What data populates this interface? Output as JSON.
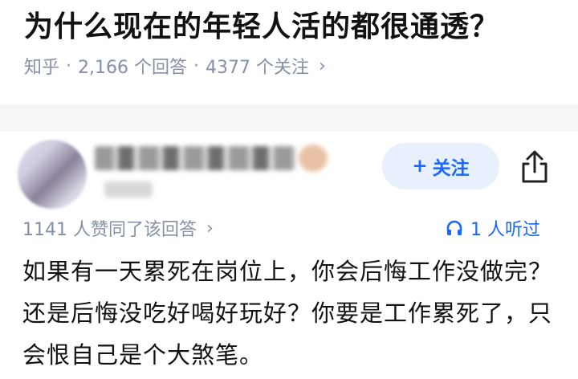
{
  "question": {
    "title": "为什么现在的年轻人活的都很通透？",
    "source": "知乎",
    "answers": "2,166 个回答",
    "followers": "4377 个关注"
  },
  "answer": {
    "follow_label": "关注",
    "approvals": "1141 人赞同了该回答",
    "listen_count": "1 人听过",
    "text": "如果有一天累死在岗位上，你会后悔工作没做完？还是后悔没吃好喝好玩好？你要是工作累死了，只会恨自己是个大煞笔。"
  },
  "colors": {
    "accent": "#1a66ff",
    "meta": "#8590a6",
    "follow_bg": "#e8f0fd"
  },
  "icons": [
    "chevron-right-icon",
    "plus-icon",
    "share-icon",
    "headphones-icon"
  ]
}
